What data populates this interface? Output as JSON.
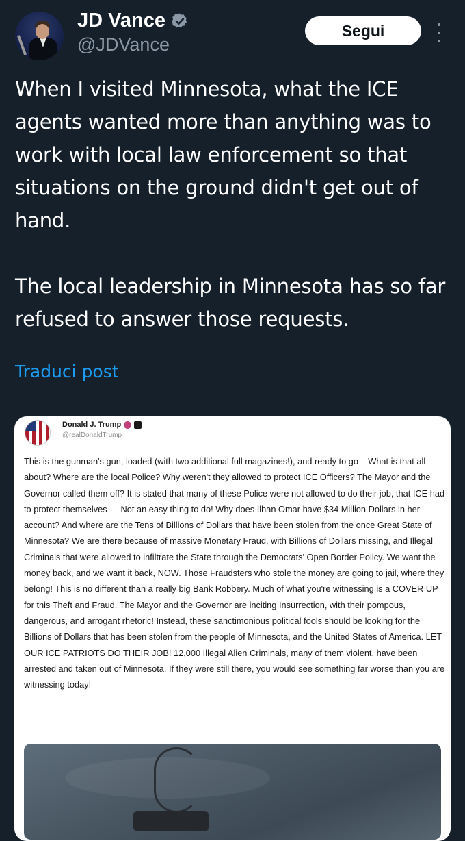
{
  "header": {
    "display_name": "JD Vance",
    "handle": "@JDVance",
    "follow_label": "Segui"
  },
  "tweet": {
    "text": "When I visited Minnesota, what the ICE agents wanted more than anything was to work with local law enforcement so that situations on the ground didn't get out of hand.\n\nThe local leadership in Minnesota has so far refused to answer those requests.",
    "translate_label": "Traduci post"
  },
  "embedded_post": {
    "author_name": "Donald J. Trump",
    "author_handle": "@realDonaldTrump",
    "body": "This is the gunman's gun, loaded (with two additional full magazines!), and ready to go – What is that all about? Where are the local Police? Why weren't they allowed to protect ICE Officers? The Mayor and the Governor called them off? It is stated that many of these Police were not allowed to do their job, that ICE had to protect themselves — Not an easy thing to do! Why does Ilhan Omar have $34 Million Dollars in her account? And where are the Tens of Billions of Dollars that have been stolen from the once Great State of Minnesota? We are there because of massive Monetary Fraud, with Billions of Dollars missing, and Illegal Criminals that were allowed to infiltrate the State through the Democrats' Open Border Policy. We want the money back, and we want it back, NOW. Those Fraudsters who stole the money are going to jail, where they belong! This is no different than a really big Bank Robbery. Much of what you're witnessing is a COVER UP for this Theft and Fraud. The Mayor and the Governor are inciting Insurrection, with their pompous, dangerous, and arrogant rhetoric! Instead, these sanctimonious political fools should be looking for the Billions of Dollars that has been stolen from the people of Minnesota, and the United States of America. LET OUR ICE PATRIOTS DO THEIR JOB! 12,000 Illegal Alien Criminals, many of them violent, have been arrested and taken out of Minnesota. If they were still there, you would see something far worse than you are witnessing today!"
  },
  "colors": {
    "background": "#15202b",
    "link": "#1d9bf0",
    "secondary_text": "#8b98a5",
    "verified_badge": "#8b98a5"
  },
  "icons": {
    "verified": "verified-badge-icon",
    "more": "more-vertical-icon"
  }
}
